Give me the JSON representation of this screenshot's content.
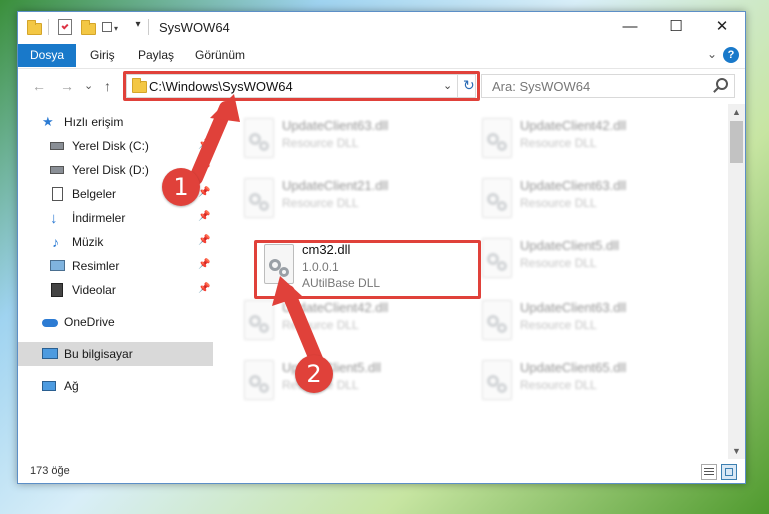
{
  "window": {
    "title": "SysWOW64",
    "minimize": "—",
    "maximize": "☐",
    "close": "✕"
  },
  "ribbon": {
    "tabs": [
      "Dosya",
      "Giriş",
      "Paylaş",
      "Görünüm"
    ],
    "expand": "⌄",
    "help": "?"
  },
  "nav": {
    "back": "←",
    "forward": "→",
    "recent": "⌄",
    "up": "↑",
    "address": "C:\\Windows\\SysWOW64",
    "address_dropdown": "⌄",
    "refresh": "↻",
    "search_placeholder": "Ara: SysWOW64"
  },
  "sidebar": {
    "items": [
      {
        "label": "Hızlı erişim",
        "icon": "star-icon"
      },
      {
        "label": "Yerel Disk (C:)",
        "icon": "drive-icon"
      },
      {
        "label": "Yerel Disk (D:)",
        "icon": "drive-icon"
      },
      {
        "label": "Belgeler",
        "icon": "documents-icon"
      },
      {
        "label": "İndirmeler",
        "icon": "download-icon"
      },
      {
        "label": "Müzik",
        "icon": "music-icon"
      },
      {
        "label": "Resimler",
        "icon": "pictures-icon"
      },
      {
        "label": "Videolar",
        "icon": "videos-icon"
      },
      {
        "label": "OneDrive",
        "icon": "cloud-icon"
      },
      {
        "label": "Bu bilgisayar",
        "icon": "computer-icon"
      },
      {
        "label": "Ağ",
        "icon": "network-icon"
      }
    ],
    "pin_glyph": "📌"
  },
  "files": {
    "left": [
      {
        "name": "UpdateClient63.dll",
        "sub1": "Resource DLL"
      },
      {
        "name": "UpdateClient21.dll",
        "sub1": "Resource DLL"
      },
      {
        "name": "cm32.dll",
        "sub1": "1.0.0.1",
        "sub2": "AUtilBase DLL"
      },
      {
        "name": "UpdateClient42.dll",
        "sub1": "Resource DLL"
      },
      {
        "name": "UpdateClient5.dll",
        "sub1": "Resource DLL"
      }
    ],
    "right": [
      {
        "name": "UpdateClient42.dll",
        "sub1": "Resource DLL"
      },
      {
        "name": "UpdateClient63.dll",
        "sub1": "Resource DLL"
      },
      {
        "name": "UpdateClient5.dll",
        "sub1": "Resource DLL"
      },
      {
        "name": "UpdateClient63.dll",
        "sub1": "Resource DLL"
      },
      {
        "name": "UpdateClient65.dll",
        "sub1": "Resource DLL"
      }
    ]
  },
  "status": {
    "count": "173 öğe"
  },
  "callouts": {
    "one": "1",
    "two": "2"
  },
  "colors": {
    "accent": "#1979ca",
    "highlight_red": "#e0413a"
  }
}
